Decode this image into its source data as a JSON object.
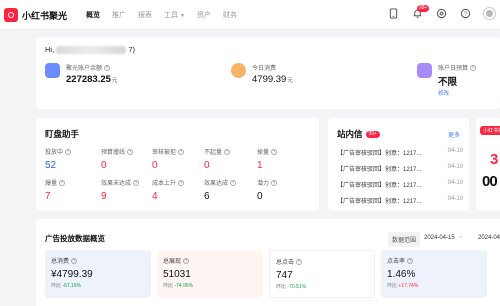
{
  "brand": {
    "name": "小红书聚光"
  },
  "nav": {
    "items": [
      "概览",
      "推广",
      "报表",
      "工具",
      "资产",
      "财务"
    ],
    "active": 0,
    "tools_caret": "▼"
  },
  "topbar": {
    "notification_count": "99+"
  },
  "account": {
    "greeting_prefix": "Hi,",
    "greeting_suffix": "7)",
    "balance_label": "聚光账户余额",
    "balance_value": "227283.25",
    "balance_unit": "元",
    "today_label": "今日消费",
    "today_value": "4799.39",
    "today_unit": "元",
    "budget_label": "账户日预算",
    "budget_value": "不限",
    "budget_link": "修改",
    "colors": {
      "balance_icon": "#6b8cff",
      "today_icon": "#f7b267",
      "budget_icon": "#a78bfa"
    }
  },
  "assistant": {
    "title": "盯盘助手",
    "stats": [
      {
        "label": "投放中",
        "value": "52",
        "color": "#2563eb"
      },
      {
        "label": "预算撞线",
        "value": "0",
        "color": "#ff2442"
      },
      {
        "label": "审核被拒",
        "value": "0",
        "color": "#ff2442"
      },
      {
        "label": "不起量",
        "value": "0",
        "color": "#ff2442"
      },
      {
        "label": "掉量",
        "value": "1",
        "color": "#ff2442"
      },
      {
        "label": "爆量",
        "value": "7",
        "color": "#ff2442"
      },
      {
        "label": "效果未达成",
        "value": "9",
        "color": "#ff2442"
      },
      {
        "label": "成本上升",
        "value": "4",
        "color": "#ff2442"
      },
      {
        "label": "效果达成",
        "value": "6",
        "color": "#111111"
      },
      {
        "label": "潜力",
        "value": "0",
        "color": "#111111"
      }
    ]
  },
  "messages": {
    "title": "站内信",
    "badge": "99+",
    "more": "更多",
    "items": [
      {
        "text": "【广告审核驳回】创意：1217...",
        "date": "04-10"
      },
      {
        "text": "【广告审核驳回】创意：1217...",
        "date": "04-10"
      },
      {
        "text": "【广告审核驳回】创意：1217...",
        "date": "04-10"
      },
      {
        "text": "【广告审核驳回】创意：1217...",
        "date": "04-10"
      }
    ]
  },
  "promo": {
    "tag": "小红书投放",
    "big": "3",
    "text": "00"
  },
  "ad_data": {
    "title": "广告投放数据概览",
    "range_label": "数据范围",
    "range_start": "2024-04-15",
    "range_sep": "~",
    "range_end": "2024-04",
    "kpis": [
      {
        "label": "总消费",
        "value": "¥4799.39",
        "change_label": "环比",
        "change": "-67.19%",
        "dir": "down",
        "bg": "#eef2fb"
      },
      {
        "label": "总展现",
        "value": "51031",
        "change_label": "环比",
        "change": "-74.95%",
        "dir": "down",
        "bg": "#fff5f2"
      },
      {
        "label": "总点击",
        "value": "747",
        "change_label": "环比",
        "change": "-70.51%",
        "dir": "down",
        "bg": "#ffffff"
      },
      {
        "label": "点击率",
        "value": "1.46%",
        "change_label": "环比",
        "change": "+17.74%",
        "dir": "up",
        "bg": "#eef2fb"
      }
    ]
  }
}
